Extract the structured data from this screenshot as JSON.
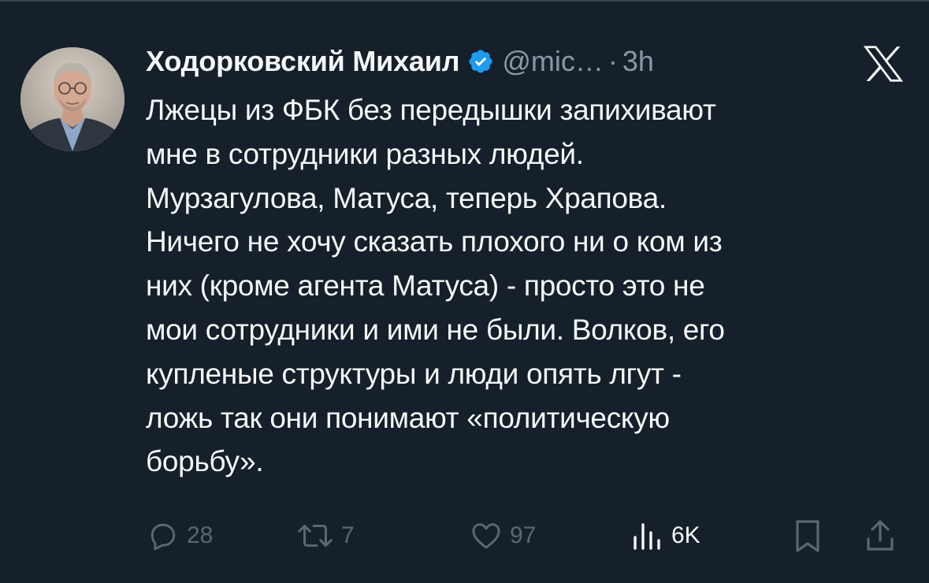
{
  "tweet": {
    "display_name": "Ходорковский Михаил",
    "handle": "@mic…",
    "separator": "·",
    "time": "3h",
    "text": "Лжецы из ФБК без передышки запихивают\nмне в сотрудники разных людей.\nМурзагулова, Матуса, теперь Храпова.\nНичего не хочу сказать плохого ни о ком из\nних (кроме агента Матуса) - просто это не\nмои сотрудники и ими не были. Волков, его\nкупленые структуры и люди опять лгут -\nложь так они понимают «политическую\nборьбу».",
    "verified": true
  },
  "actions": {
    "replies": "28",
    "retweets": "7",
    "likes": "97",
    "views": "6K"
  },
  "icons": {
    "avatar": "avatar-photo",
    "verified": "verified-badge-icon",
    "logo": "x-logo-icon",
    "reply": "reply-icon",
    "retweet": "retweet-icon",
    "like": "heart-icon",
    "views": "views-icon",
    "bookmark": "bookmark-icon",
    "share": "share-icon"
  },
  "colors": {
    "background": "#15202b",
    "text": "#f7f9f9",
    "secondary_text": "#8b98a5",
    "verified_blue": "#1d9bf0",
    "action_icons": "#5c6670"
  }
}
